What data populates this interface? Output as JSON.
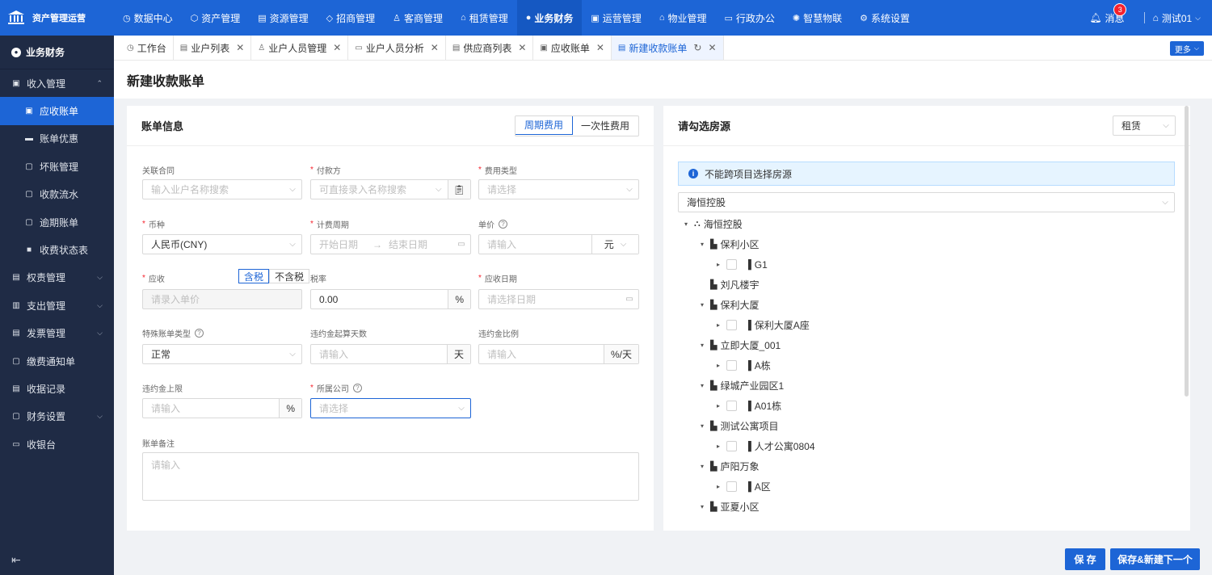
{
  "app": {
    "title": "资产管理运营"
  },
  "topnav": [
    {
      "icon": "◷",
      "label": "数据中心"
    },
    {
      "icon": "⬡",
      "label": "资产管理"
    },
    {
      "icon": "▤",
      "label": "资源管理"
    },
    {
      "icon": "◇",
      "label": "招商管理"
    },
    {
      "icon": "♙",
      "label": "客商管理"
    },
    {
      "icon": "⌂",
      "label": "租赁管理"
    },
    {
      "icon": "●",
      "label": "业务财务"
    },
    {
      "icon": "▣",
      "label": "运营管理"
    },
    {
      "icon": "⌂",
      "label": "物业管理"
    },
    {
      "icon": "▭",
      "label": "行政办公"
    },
    {
      "icon": "✺",
      "label": "智慧物联"
    },
    {
      "icon": "⚙",
      "label": "系统设置"
    }
  ],
  "topright": {
    "messages": "消息",
    "badge": "3",
    "user": "测试01"
  },
  "sidebar": {
    "header": "业务财务",
    "items": [
      {
        "label": "收入管理",
        "icon": "▣"
      },
      {
        "label": "应收账单",
        "icon": "▣"
      },
      {
        "label": "账单优惠",
        "icon": "▬"
      },
      {
        "label": "坏账管理",
        "icon": "▢"
      },
      {
        "label": "收款流水",
        "icon": "▢"
      },
      {
        "label": "逾期账单",
        "icon": "▢"
      },
      {
        "label": "收费状态表",
        "icon": "■"
      },
      {
        "label": "权责管理",
        "icon": "▤"
      },
      {
        "label": "支出管理",
        "icon": "▥"
      },
      {
        "label": "发票管理",
        "icon": "▤"
      },
      {
        "label": "缴费通知单",
        "icon": "▢"
      },
      {
        "label": "收据记录",
        "icon": "▤"
      },
      {
        "label": "财务设置",
        "icon": "▢"
      },
      {
        "label": "收银台",
        "icon": "▭"
      }
    ]
  },
  "tabs": [
    {
      "icon": "◷",
      "label": "工作台"
    },
    {
      "icon": "▤",
      "label": "业户列表"
    },
    {
      "icon": "♙",
      "label": "业户人员管理"
    },
    {
      "icon": "▭",
      "label": "业户人员分析"
    },
    {
      "icon": "▤",
      "label": "供应商列表"
    },
    {
      "icon": "▣",
      "label": "应收账单"
    },
    {
      "icon": "▤",
      "label": "新建收款账单"
    }
  ],
  "more": "更多",
  "page_title": "新建收款账单",
  "bill": {
    "title": "账单信息",
    "seg_periodic": "周期费用",
    "seg_onetime": "一次性费用",
    "contract_label": "关联合同",
    "contract_ph": "输入业户名称搜索",
    "payer_label": "付款方",
    "payer_ph": "可直接录入名称搜索",
    "feetype_label": "费用类型",
    "feetype_ph": "请选择",
    "currency_label": "币种",
    "currency_val": "人民币(CNY)",
    "period_label": "计费周期",
    "period_start": "开始日期",
    "period_arrow": "→",
    "period_end": "结束日期",
    "price_label": "单价",
    "price_ph": "请输入",
    "price_unit": "元",
    "due_label": "应收",
    "tax_incl": "含税",
    "tax_excl": "不含税",
    "due_ph": "请录入单价",
    "taxrate_label": "税率",
    "taxrate_val": "0.00",
    "taxrate_unit": "%",
    "duedate_label": "应收日期",
    "duedate_ph": "请选择日期",
    "special_label": "特殊账单类型",
    "special_val": "正常",
    "penalty_days_label": "违约金起算天数",
    "penalty_days_ph": "请输入",
    "penalty_days_unit": "天",
    "penalty_ratio_label": "违约金比例",
    "penalty_ratio_ph": "请输入",
    "penalty_ratio_unit": "%/天",
    "penalty_cap_label": "违约金上限",
    "penalty_cap_ph": "请输入",
    "penalty_cap_unit": "%",
    "company_label": "所属公司",
    "company_ph": "请选择",
    "remark_label": "账单备注",
    "remark_ph": "请输入"
  },
  "house": {
    "title": "请勾选房源",
    "type": "租赁",
    "alert": "不能跨项目选择房源",
    "project": "海恒控股",
    "tree": [
      {
        "label": "海恒控股",
        "level": 0,
        "toggle": "▾",
        "icon": "⛬",
        "checkbox": false
      },
      {
        "label": "保利小区",
        "level": 1,
        "toggle": "▾",
        "icon": "▙",
        "checkbox": false
      },
      {
        "label": "G1",
        "level": 2,
        "toggle": "▸",
        "icon": "▐",
        "checkbox": true
      },
      {
        "label": "刘凡楼宇",
        "level": 1,
        "toggle": "",
        "icon": "▙",
        "checkbox": false
      },
      {
        "label": "保利大厦",
        "level": 1,
        "toggle": "▾",
        "icon": "▙",
        "checkbox": false
      },
      {
        "label": "保利大厦A座",
        "level": 2,
        "toggle": "▸",
        "icon": "▐",
        "checkbox": true
      },
      {
        "label": "立即大厦_001",
        "level": 1,
        "toggle": "▾",
        "icon": "▙",
        "checkbox": false
      },
      {
        "label": "A栋",
        "level": 2,
        "toggle": "▸",
        "icon": "▐",
        "checkbox": true
      },
      {
        "label": "绿城产业园区1",
        "level": 1,
        "toggle": "▾",
        "icon": "▙",
        "checkbox": false
      },
      {
        "label": "A01栋",
        "level": 2,
        "toggle": "▸",
        "icon": "▐",
        "checkbox": true
      },
      {
        "label": "测试公寓项目",
        "level": 1,
        "toggle": "▾",
        "icon": "▙",
        "checkbox": false
      },
      {
        "label": "人才公寓0804",
        "level": 2,
        "toggle": "▸",
        "icon": "▐",
        "checkbox": true
      },
      {
        "label": "庐阳万象",
        "level": 1,
        "toggle": "▾",
        "icon": "▙",
        "checkbox": false
      },
      {
        "label": "A区",
        "level": 2,
        "toggle": "▸",
        "icon": "▐",
        "checkbox": true
      },
      {
        "label": "亚夏小区",
        "level": 1,
        "toggle": "▾",
        "icon": "▙",
        "checkbox": false
      }
    ]
  },
  "buttons": {
    "save": "保 存",
    "save_next": "保存&新建下一个"
  },
  "colors": {
    "primary": "#1d65d6",
    "sidebar": "#1f2b45"
  }
}
